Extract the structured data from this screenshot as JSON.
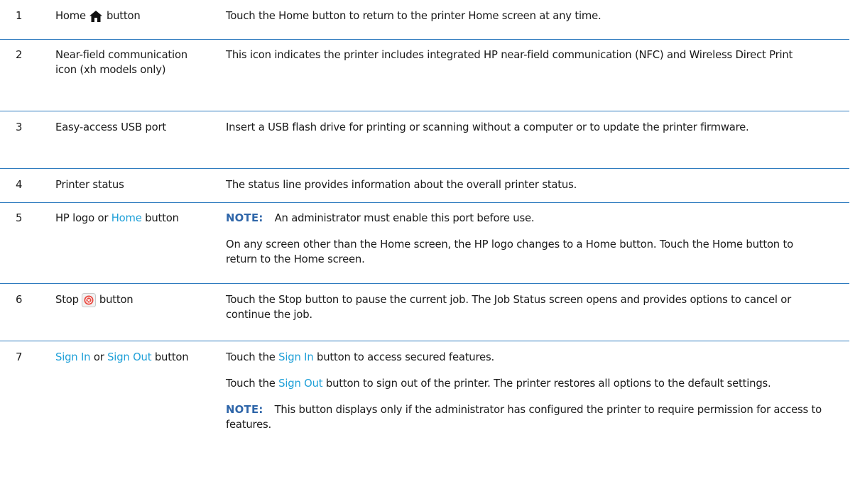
{
  "rows": [
    {
      "num": "1",
      "item_prefix": "Home",
      "item_icon": "home-icon",
      "item_suffix": "button",
      "desc": "Touch the Home button to return to the printer Home screen at any time."
    },
    {
      "num": "2",
      "item": "Near-field communication icon (xh models only)",
      "desc": "This icon indicates the printer includes integrated HP near-field communication (NFC) and Wireless Direct Print"
    },
    {
      "num": "3",
      "item": "Easy-access USB port",
      "desc": "Insert a USB flash drive for printing or scanning without a computer or to update the printer firmware."
    },
    {
      "num": "4",
      "item": "Printer status",
      "desc": "The status line provides information about the overall printer status."
    },
    {
      "num": "5",
      "item_prefix": "HP logo or",
      "item_link": "Home",
      "item_suffix": "button",
      "note_label": "NOTE:",
      "note_text": "An administrator must enable this port before use.",
      "desc": "On any screen other than the Home screen, the HP logo changes to a Home button. Touch the Home button to return to the Home screen."
    },
    {
      "num": "6",
      "item_prefix": "Stop",
      "item_icon": "stop-icon",
      "item_suffix": "button",
      "desc": "Touch the Stop button to pause the current job. The Job Status screen opens and provides options to cancel or continue the job."
    },
    {
      "num": "7",
      "item_link1": "Sign In",
      "item_mid": "or",
      "item_link2": "Sign Out",
      "item_suffix": "button",
      "desc1_prefix": "Touch the",
      "desc1_link": "Sign In",
      "desc1_suffix": "button to access secured features.",
      "desc2_prefix": "Touch the",
      "desc2_link": "Sign Out",
      "desc2_suffix": "button to sign out of the printer. The printer restores all options to the default settings.",
      "note_label": "NOTE:",
      "note_text": "This button displays only if the administrator has configured the printer to require permission for access to features."
    }
  ],
  "colors": {
    "link": "#1fa0d8",
    "note_label": "#2f66a9",
    "rule": "#2e7bbf",
    "stop_icon": "#e8453c"
  }
}
